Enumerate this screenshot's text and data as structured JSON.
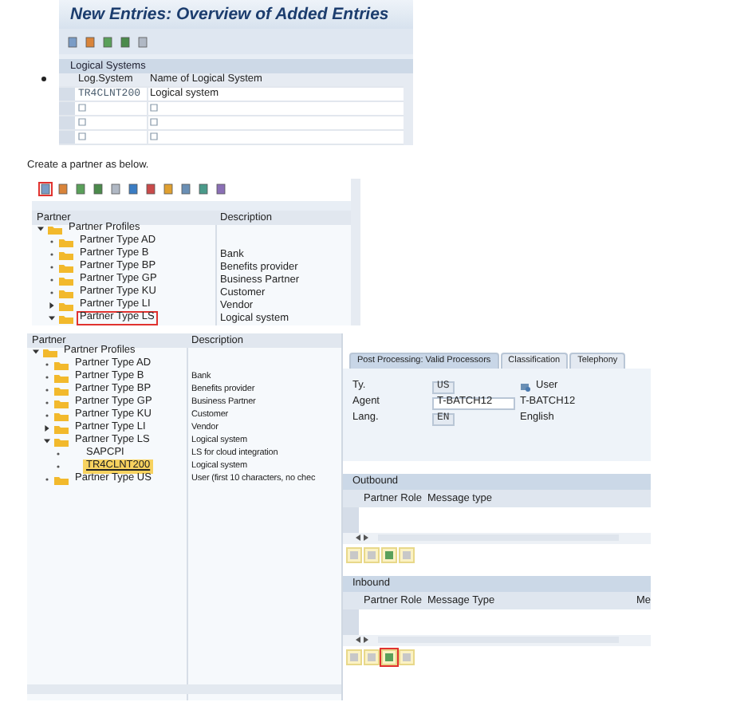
{
  "logical_systems": {
    "title": "New Entries: Overview of Added Entries",
    "toolbar": [
      {
        "highlighted": false
      },
      {
        "highlighted": false
      },
      {
        "highlighted": false
      },
      {
        "highlighted": false
      },
      {
        "highlighted": false
      }
    ],
    "section": "Logical Systems",
    "columns": [
      "Log.System",
      "Name of Logical System"
    ],
    "rows": [
      {
        "kind": "entry",
        "log_system": "TR4CLNT200",
        "name": "Logical system"
      },
      {
        "kind": "blank"
      },
      {
        "kind": "blank"
      },
      {
        "kind": "blank"
      }
    ]
  },
  "instruction": "Create a partner as below.",
  "partner_tree": {
    "toolbar": [
      {
        "highlighted": true
      },
      {
        "highlighted": false
      },
      {
        "highlighted": false
      },
      {
        "highlighted": false
      },
      {
        "highlighted": false
      },
      {
        "highlighted": false
      },
      {
        "highlighted": false
      },
      {
        "highlighted": false
      },
      {
        "highlighted": false
      },
      {
        "highlighted": false
      },
      {
        "highlighted": false
      }
    ],
    "columns": [
      "Partner",
      "Description"
    ],
    "nodes": [
      {
        "label": "Partner Profiles",
        "kind": "folder",
        "expandable": true,
        "expanded": true,
        "highlighted": false,
        "selected": false,
        "children": [
          {
            "label": "Partner Type AD",
            "kind": "folder",
            "expandable": false,
            "highlighted": false,
            "selected": false
          },
          {
            "label": "Partner Type B",
            "description": "Bank",
            "kind": "folder",
            "expandable": false,
            "highlighted": false,
            "selected": false
          },
          {
            "label": "Partner Type BP",
            "description": "Benefits provider",
            "kind": "folder",
            "expandable": false,
            "highlighted": false,
            "selected": false
          },
          {
            "label": "Partner Type GP",
            "description": "Business Partner",
            "kind": "folder",
            "expandable": false,
            "highlighted": false,
            "selected": false
          },
          {
            "label": "Partner Type KU",
            "description": "Customer",
            "kind": "folder",
            "expandable": false,
            "highlighted": false,
            "selected": false
          },
          {
            "label": "Partner Type LI",
            "description": "Vendor",
            "kind": "folder",
            "expandable": true,
            "expanded": false,
            "highlighted": false,
            "selected": false
          },
          {
            "label": "Partner Type LS",
            "description": "Logical system",
            "kind": "folder",
            "expandable": true,
            "expanded": true,
            "highlighted": true,
            "selected": false
          }
        ]
      }
    ]
  },
  "partner_tree_2": {
    "columns": [
      "Partner",
      "Description"
    ],
    "nodes": [
      {
        "label": "Partner Profiles",
        "kind": "folder",
        "expandable": true,
        "expanded": true,
        "highlighted": false,
        "selected": false,
        "children": [
          {
            "label": "Partner Type AD",
            "kind": "folder",
            "expandable": false,
            "highlighted": false,
            "selected": false
          },
          {
            "label": "Partner Type B",
            "description": "Bank",
            "kind": "folder",
            "expandable": false,
            "highlighted": false,
            "selected": false
          },
          {
            "label": "Partner Type BP",
            "description": "Benefits provider",
            "kind": "folder",
            "expandable": false,
            "highlighted": false,
            "selected": false
          },
          {
            "label": "Partner Type GP",
            "description": "Business Partner",
            "kind": "folder",
            "expandable": false,
            "highlighted": false,
            "selected": false
          },
          {
            "label": "Partner Type KU",
            "description": "Customer",
            "kind": "folder",
            "expandable": false,
            "highlighted": false,
            "selected": false
          },
          {
            "label": "Partner Type LI",
            "description": "Vendor",
            "kind": "folder",
            "expandable": true,
            "expanded": false,
            "highlighted": false,
            "selected": false
          },
          {
            "label": "Partner Type LS",
            "description": "Logical system",
            "kind": "folder",
            "expandable": true,
            "expanded": true,
            "highlighted": false,
            "selected": false,
            "children": [
              {
                "label": "SAPCPI",
                "description": "LS for cloud integration",
                "kind": "item",
                "expandable": false,
                "highlighted": false,
                "selected": false
              },
              {
                "label": "TR4CLNT200",
                "description": "Logical system",
                "kind": "item",
                "expandable": false,
                "highlighted": false,
                "selected": true
              }
            ]
          },
          {
            "label": "Partner Type US",
            "description": "User (first 10 characters, no chec",
            "kind": "folder",
            "expandable": false,
            "highlighted": false,
            "selected": false
          }
        ]
      }
    ]
  },
  "detail": {
    "tabs": [
      {
        "label": "Post Processing: Valid Processors",
        "selected": true
      },
      {
        "label": "Classification",
        "selected": false
      },
      {
        "label": "Telephony",
        "selected": false
      }
    ],
    "fields": [
      {
        "label": "Ty.",
        "value": "US",
        "editable": false,
        "text": "User"
      },
      {
        "label": "Agent",
        "value": "T-BATCH12",
        "editable": true,
        "text": "T-BATCH12"
      },
      {
        "label": "Lang.",
        "value": "EN",
        "editable": false,
        "text": "English"
      }
    ],
    "outbound": {
      "title": "Outbound",
      "columns": [
        "Partner Role",
        "Message type"
      ],
      "buttons": [
        {
          "highlighted": false
        },
        {
          "highlighted": false
        },
        {
          "highlighted": false
        },
        {
          "highlighted": false
        }
      ]
    },
    "inbound": {
      "title": "Inbound",
      "columns": [
        "Partner Role",
        "Message Type",
        "Me"
      ],
      "buttons": [
        {
          "highlighted": false
        },
        {
          "highlighted": false
        },
        {
          "highlighted": true
        },
        {
          "highlighted": false
        }
      ]
    }
  }
}
